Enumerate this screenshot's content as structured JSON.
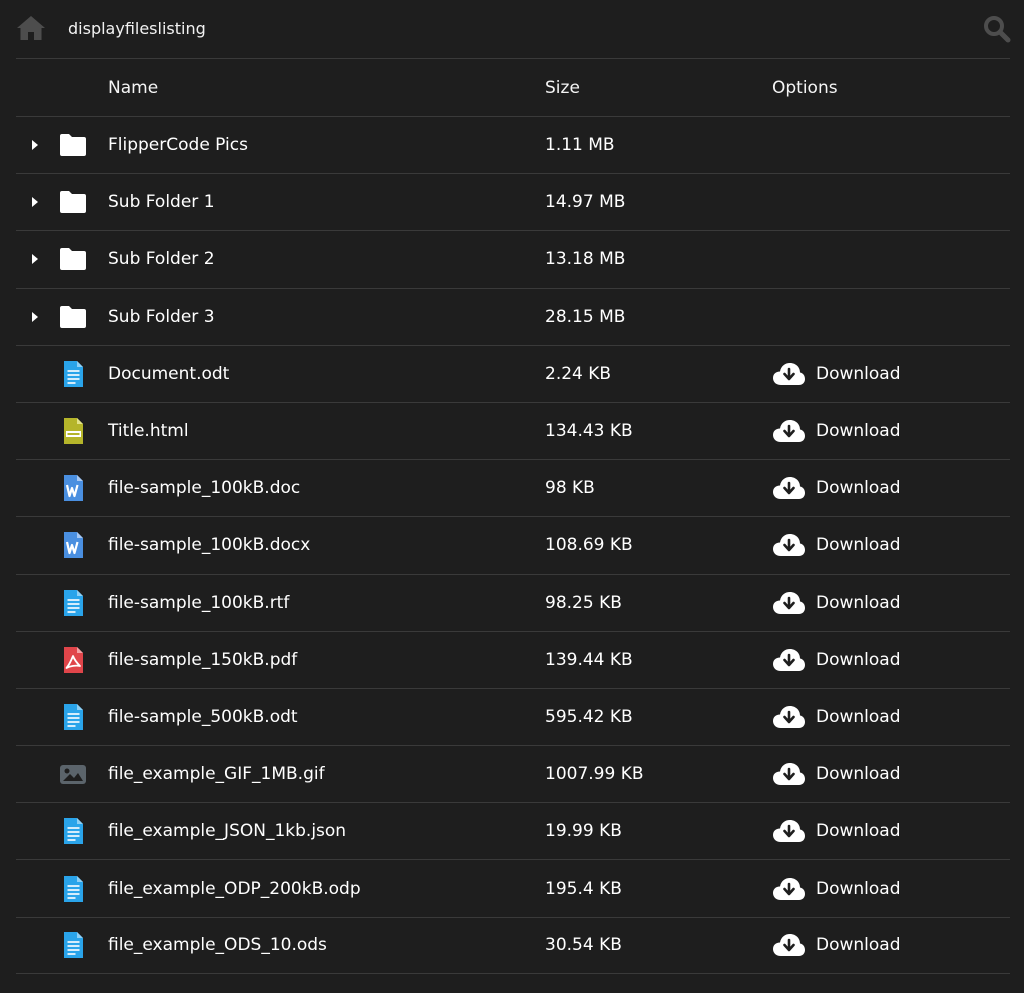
{
  "topbar": {
    "breadcrumb": "displayfileslisting",
    "home_icon": "home-icon",
    "search_icon": "search-icon"
  },
  "table": {
    "headers": {
      "name": "Name",
      "size": "Size",
      "options": "Options"
    },
    "rows": [
      {
        "name": "FlipperCode Pics",
        "size": "1.11 MB",
        "kind": "folder",
        "download": ""
      },
      {
        "name": "Sub Folder 1",
        "size": "14.97 MB",
        "kind": "folder",
        "download": ""
      },
      {
        "name": "Sub Folder 2",
        "size": "13.18 MB",
        "kind": "folder",
        "download": ""
      },
      {
        "name": "Sub Folder 3",
        "size": "28.15 MB",
        "kind": "folder",
        "download": ""
      },
      {
        "name": "Document.odt",
        "size": "2.24 KB",
        "kind": "doc",
        "download": "Download"
      },
      {
        "name": "Title.html",
        "size": "134.43 KB",
        "kind": "html",
        "download": "Download"
      },
      {
        "name": "file-sample_100kB.doc",
        "size": "98 KB",
        "kind": "word",
        "download": "Download"
      },
      {
        "name": "file-sample_100kB.docx",
        "size": "108.69 KB",
        "kind": "word",
        "download": "Download"
      },
      {
        "name": "file-sample_100kB.rtf",
        "size": "98.25 KB",
        "kind": "doc",
        "download": "Download"
      },
      {
        "name": "file-sample_150kB.pdf",
        "size": "139.44 KB",
        "kind": "pdf",
        "download": "Download"
      },
      {
        "name": "file-sample_500kB.odt",
        "size": "595.42 KB",
        "kind": "doc",
        "download": "Download"
      },
      {
        "name": "file_example_GIF_1MB.gif",
        "size": "1007.99 KB",
        "kind": "image",
        "download": "Download"
      },
      {
        "name": "file_example_JSON_1kb.json",
        "size": "19.99 KB",
        "kind": "doc",
        "download": "Download"
      },
      {
        "name": "file_example_ODP_200kB.odp",
        "size": "195.4 KB",
        "kind": "doc",
        "download": "Download"
      },
      {
        "name": "file_example_ODS_10.ods",
        "size": "30.54 KB",
        "kind": "doc",
        "download": "Download"
      }
    ]
  },
  "colors": {
    "background": "#1e1e1e",
    "divider": "#3a3a3a",
    "doc_blue": "#2aa4ea",
    "word_blue": "#4a8fe0",
    "html_olive": "#b5b52a",
    "pdf_red": "#e0454a",
    "image_gray": "#5b646b",
    "icon_gray": "#4d4d4d"
  }
}
